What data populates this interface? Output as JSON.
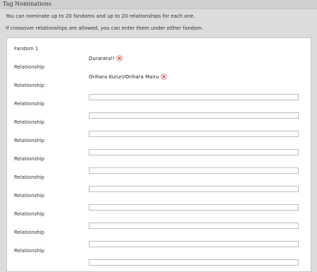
{
  "header": {
    "title": "Tag Nominations"
  },
  "intro": {
    "line1": "You can nominate up to 20 fandoms and up to 20 relationships for each one.",
    "line2": "If crossover relationships are allowed, you can enter them under either fandom."
  },
  "form": {
    "fandom": {
      "label": "Fandom 1",
      "tag": "Durarara!!"
    },
    "relationship_label": "Relationship",
    "relationships": [
      {
        "label": "Relationship",
        "tag": "Orihara Kururi/Orihara Mairu",
        "value": ""
      },
      {
        "label": "Relationship",
        "tag": "",
        "value": ""
      },
      {
        "label": "Relationship",
        "tag": "",
        "value": ""
      },
      {
        "label": "Relationship",
        "tag": "",
        "value": ""
      },
      {
        "label": "Relationship",
        "tag": "",
        "value": ""
      },
      {
        "label": "Relationship",
        "tag": "",
        "value": ""
      },
      {
        "label": "Relationship",
        "tag": "",
        "value": ""
      },
      {
        "label": "Relationship",
        "tag": "",
        "value": ""
      },
      {
        "label": "Relationship",
        "tag": "",
        "value": ""
      },
      {
        "label": "Relationship",
        "tag": "",
        "value": ""
      },
      {
        "label": "Relationship",
        "tag": "",
        "value": ""
      }
    ]
  },
  "colors": {
    "remove_x": "#cc2222",
    "border": "#bdbdbd"
  },
  "icons": {
    "remove": "close-icon"
  }
}
